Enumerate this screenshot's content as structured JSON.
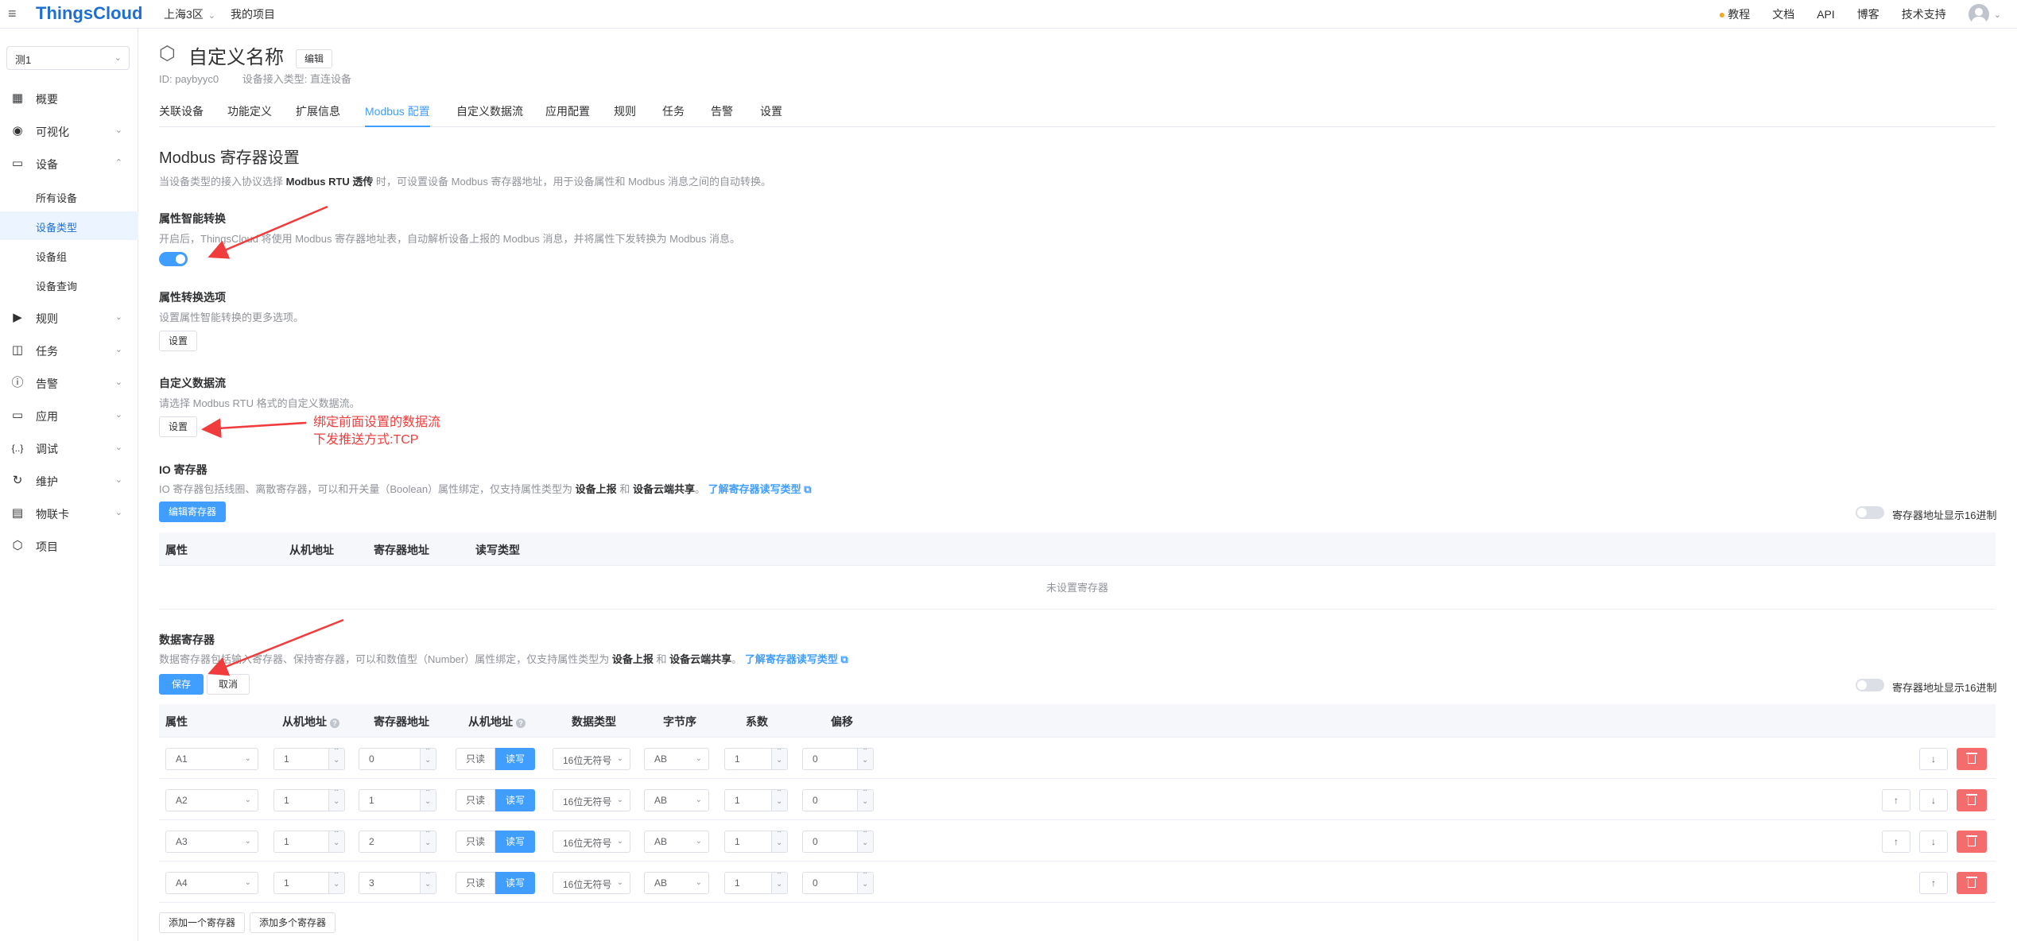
{
  "topbar": {
    "logo": "ThingsCloud",
    "region": "上海3区",
    "project": "我的项目",
    "links": [
      "教程",
      "文档",
      "API",
      "博客",
      "技术支持"
    ]
  },
  "sidebar": {
    "selector": "测1",
    "items": [
      {
        "label": "概要",
        "icon": "dashboard-icon",
        "glyph": "▦",
        "arrow": ""
      },
      {
        "label": "可视化",
        "icon": "visual-icon",
        "glyph": "◉",
        "arrow": "⌄"
      },
      {
        "label": "设备",
        "icon": "device-icon",
        "glyph": "▭",
        "arrow": "⌃"
      },
      {
        "label": "规则",
        "icon": "rule-icon",
        "glyph": "▶",
        "arrow": "⌄"
      },
      {
        "label": "任务",
        "icon": "task-icon",
        "glyph": "◫",
        "arrow": "⌄"
      },
      {
        "label": "告警",
        "icon": "alarm-icon",
        "glyph": "ⓘ",
        "arrow": "⌄"
      },
      {
        "label": "应用",
        "icon": "app-icon",
        "glyph": "▭",
        "arrow": "⌄"
      },
      {
        "label": "调试",
        "icon": "debug-icon",
        "glyph": "{..}",
        "arrow": "⌄"
      },
      {
        "label": "维护",
        "icon": "maintain-icon",
        "glyph": "↻",
        "arrow": "⌄"
      },
      {
        "label": "物联卡",
        "icon": "sim-card-icon",
        "glyph": "▤",
        "arrow": "⌄"
      },
      {
        "label": "项目",
        "icon": "project-icon",
        "glyph": "⬡",
        "arrow": ""
      }
    ],
    "device_sub": [
      "所有设备",
      "设备类型",
      "设备组",
      "设备查询"
    ]
  },
  "header": {
    "title": "自定义名称",
    "edit": "编辑",
    "id": "ID: paybyyc0",
    "access_type": "设备接入类型: 直连设备"
  },
  "tabs": [
    "关联设备",
    "功能定义",
    "扩展信息",
    "Modbus 配置",
    "自定义数据流",
    "应用配置",
    "规则",
    "任务",
    "告警",
    "设置"
  ],
  "section": {
    "title": "Modbus 寄存器设置",
    "desc_pre": "当设备类型的接入协议选择",
    "desc_bold": "Modbus RTU 透传",
    "desc_post": "时，可设置设备 Modbus 寄存器地址，用于设备属性和 Modbus 消息之间的自动转换。"
  },
  "smart": {
    "title": "属性智能转换",
    "desc": "开启后，ThingsCloud 将使用 Modbus 寄存器地址表，自动解析设备上报的 Modbus 消息，并将属性下发转换为 Modbus 消息。"
  },
  "convert_opts": {
    "title": "属性转换选项",
    "desc": "设置属性智能转换的更多选项。",
    "button": "设置"
  },
  "custom_stream": {
    "title": "自定义数据流",
    "desc": "请选择 Modbus RTU 格式的自定义数据流。",
    "button": "设置"
  },
  "annotation": {
    "line1": "绑定前面设置的数据流",
    "line2": "下发推送方式:TCP"
  },
  "io": {
    "title": "IO 寄存器",
    "desc_pre": "IO 寄存器包括线圈、离散寄存器，可以和开关量（Boolean）属性绑定，仅支持属性类型为",
    "bold1": "设备上报",
    "mid": "和",
    "bold2": "设备云端共享",
    "end": "。",
    "link": "了解寄存器读写类型",
    "edit_button": "编辑寄存器",
    "hex_toggle": "寄存器地址显示16进制",
    "columns": [
      "属性",
      "从机地址",
      "寄存器地址",
      "读写类型"
    ],
    "empty": "未设置寄存器"
  },
  "data_reg": {
    "title": "数据寄存器",
    "desc_pre": "数据寄存器包括输入寄存器、保持寄存器，可以和数值型（Number）属性绑定，仅支持属性类型为",
    "bold1": "设备上报",
    "mid": "和",
    "bold2": "设备云端共享",
    "end": "。",
    "link": "了解寄存器读写类型",
    "save": "保存",
    "cancel": "取消",
    "hex_toggle": "寄存器地址显示16进制",
    "columns": [
      "属性",
      "从机地址",
      "寄存器地址",
      "从机地址",
      "数据类型",
      "字节序",
      "系数",
      "偏移"
    ],
    "rw_options": [
      "只读",
      "读写"
    ],
    "rows": [
      {
        "attr": "A1",
        "slave": "1",
        "addr": "0",
        "dtype": "16位无符号",
        "order": "AB",
        "coef": "1",
        "offset": "0"
      },
      {
        "attr": "A2",
        "slave": "1",
        "addr": "1",
        "dtype": "16位无符号",
        "order": "AB",
        "coef": "1",
        "offset": "0"
      },
      {
        "attr": "A3",
        "slave": "1",
        "addr": "2",
        "dtype": "16位无符号",
        "order": "AB",
        "coef": "1",
        "offset": "0"
      },
      {
        "attr": "A4",
        "slave": "1",
        "addr": "3",
        "dtype": "16位无符号",
        "order": "AB",
        "coef": "1",
        "offset": "0"
      }
    ],
    "add_one": "添加一个寄存器",
    "add_many": "添加多个寄存器"
  },
  "colors": {
    "primary": "#409eff",
    "danger": "#f56c6c",
    "annotation": "#f03c3c"
  }
}
